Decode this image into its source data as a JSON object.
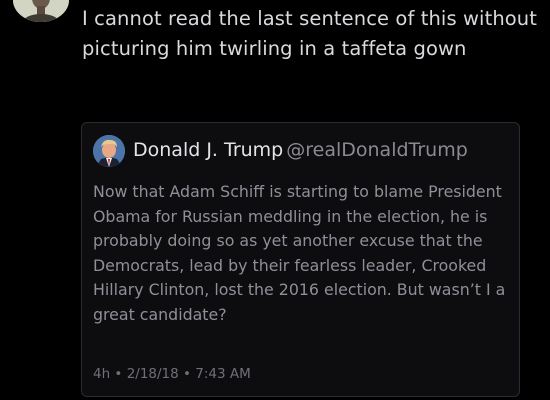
{
  "tweet": {
    "text": "I cannot read the last sentence of this without picturing him twirling in a taffeta gown"
  },
  "quoted_tweet": {
    "author_name": "Donald J. Trump",
    "author_handle": "@realDonaldTrump",
    "text": "Now that Adam Schiff is starting to blame President Obama for Russian meddling in the election, he is probably doing so as yet another excuse that the Democrats, lead by their fearless leader, Crooked Hillary Clinton, lost the 2016 election. But wasn’t I a great candidate?",
    "meta": "4h • 2/18/18 • 7:43 AM"
  },
  "colors": {
    "background": "#000000",
    "primary_text": "#d9d9de",
    "secondary_text": "#8f8f98",
    "card_border": "#2c2c30"
  }
}
